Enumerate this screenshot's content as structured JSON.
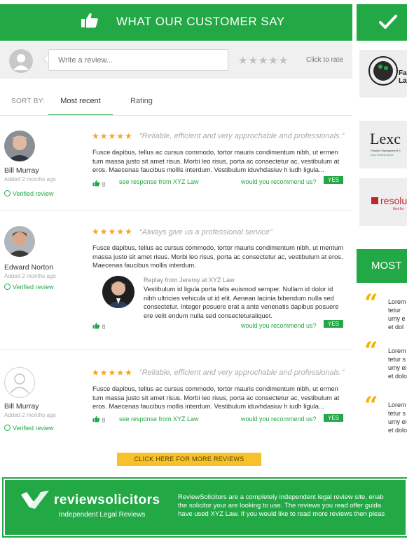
{
  "header": {
    "title": "WHAT OUR CUSTOMER SAY"
  },
  "write": {
    "placeholder": "Write a review...",
    "rate_stars": "★★★★★",
    "rate_label": "Click to rate"
  },
  "sort": {
    "label": "SORT BY:",
    "tabs": [
      {
        "label": "Most recent",
        "active": true
      },
      {
        "label": "Rating",
        "active": false
      }
    ]
  },
  "reviews": [
    {
      "name": "Bill Murray",
      "added": "Added 2 months ago",
      "verified": "Verified review",
      "stars": "★★★★★",
      "rating": 5,
      "quote": "“Reliable, efficient and very approchable and professionals.”",
      "text": "Fusce dapibus, tellus ac cursus commodo, tortor mauris condimentum nibh, ut ermen tum massa justo sit amet risus. Morbi leo risus, porta ac consectetur ac, vestibulum at eros. Maecenas faucibus mollis interdum. Vestibulum iduvhdasiuv h iudh ligula...",
      "likes": "8",
      "see_response": "see response from XYZ Law",
      "recommend": "would you recommend us?",
      "answer": "YES"
    },
    {
      "name": "Edward Norton",
      "added": "Added 2 months ago",
      "verified": "Verified review",
      "stars": "★★★★★",
      "rating": 5,
      "quote": "“Always give us a professional service”",
      "text": "Fusce dapibus, tellus ac cursus commodo, tortor mauris condimentum nibh, ut mentum massa justo sit amet risus. Morbi leo risus, porta ac consectetur ac, vestibulum at eros. Maecenas faucibus mollis interdum.",
      "reply_by": "Replay from Jeremy at XYZ Law",
      "reply_text": "Vestibulum id ligula porta felis euismod semper. Nullam id dolor id nibh ultricies vehicula ut id elit. Aenean lacinia bibendum nulla sed consectetur. Integer posuere erat a ante venenatis dapibus posuere ere velit endum nulla sed consecteturaliquet.",
      "likes": "8",
      "recommend": "would you recommend us?",
      "answer": "YES"
    },
    {
      "name": "Bill Murray",
      "added": "Added 2 months ago",
      "verified": "Verified review",
      "stars": "★★★★★",
      "rating": 5,
      "quote": "“Reliable, efficient and very approchable and professionals.”",
      "text": "Fusce dapibus, tellus ac cursus commodo, tortor mauris condimentum nibh, ut ermen tum massa justo sit amet risus. Morbi leo risus, porta ac consectetur ac, vestibulum at eros. Maecenas faucibus mollis interdum. Vestibulum iduvhdasiuv h iudh ligula...",
      "likes": "8",
      "see_response": "see response from XYZ Law",
      "recommend": "would you recommend us?",
      "answer": "YES"
    }
  ],
  "more_button": "CLICK HERE FOR MORE REVIEWS",
  "footer": {
    "brand": "reviewsolicitors",
    "tagline": "Independent Legal Reviews",
    "text": [
      "ReviewSolicitors are a completely independent legal review site, enab",
      "the solicitor your are looking to use. The reviews you read offer guida",
      "have used XYZ Law. If you would like to read more reviews then pleas"
    ]
  },
  "sidebar": {
    "logos": [
      {
        "lines": [
          "Fa",
          "Lav"
        ]
      },
      {
        "lines": [
          "Lexc",
          "Practice Management S",
          "Law Society Accre"
        ]
      },
      {
        "lines": [
          "resolu",
          "first for"
        ]
      }
    ],
    "most_title": "MOST",
    "quotes": [
      {
        "lines": [
          "Lorem",
          "tetur",
          "umy e",
          "et dol"
        ]
      },
      {
        "lines": [
          "Lorem",
          "tetur s",
          "umy ei",
          "et dolo"
        ]
      },
      {
        "lines": [
          "Lorem",
          "tetur s",
          "umy ei",
          "et dolo"
        ]
      }
    ]
  },
  "colors": {
    "brand_green": "#22a845",
    "star_gold": "#f5a623",
    "button_yellow": "#f7c12a",
    "quote_yellow": "#f5b200"
  }
}
